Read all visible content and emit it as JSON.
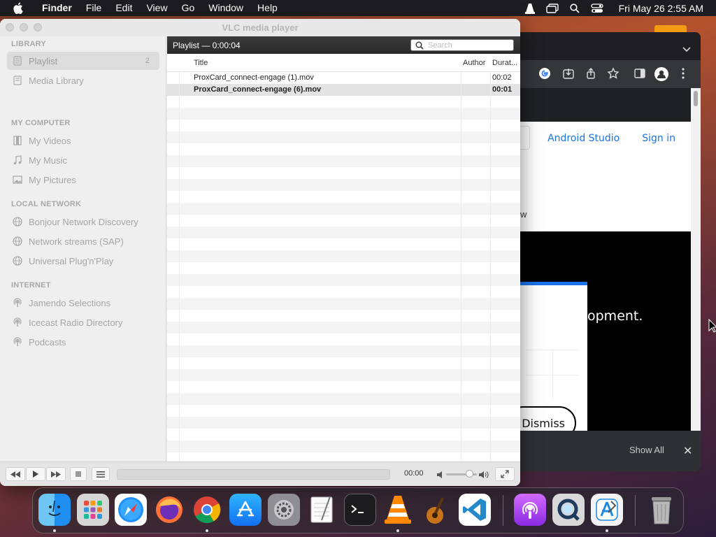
{
  "menubar": {
    "app_name": "Finder",
    "menus": [
      "File",
      "Edit",
      "View",
      "Go",
      "Window",
      "Help"
    ],
    "clock": "Fri May 26  2:55 AM"
  },
  "browser": {
    "header_links": [
      "Android Studio",
      "Sign in"
    ],
    "partial_text": "w",
    "hero_text": "opment.",
    "dismiss_label": "Dismiss",
    "download_bar": {
      "show_all": "Show All",
      "close": "✕"
    }
  },
  "vlc": {
    "title": "VLC media player",
    "sidebar": {
      "sections": [
        {
          "label": "LIBRARY",
          "items": [
            {
              "label": "Playlist",
              "count": "2",
              "icon": "playlist-icon",
              "selected": true
            },
            {
              "label": "Media Library",
              "icon": "media-library-icon"
            }
          ]
        },
        {
          "label": "MY COMPUTER",
          "items": [
            {
              "label": "My Videos",
              "icon": "film-icon"
            },
            {
              "label": "My Music",
              "icon": "music-note-icon"
            },
            {
              "label": "My Pictures",
              "icon": "picture-icon"
            }
          ]
        },
        {
          "label": "LOCAL NETWORK",
          "items": [
            {
              "label": "Bonjour Network Discovery",
              "icon": "network-globe-icon"
            },
            {
              "label": "Network streams (SAP)",
              "icon": "network-globe-icon"
            },
            {
              "label": "Universal Plug'n'Play",
              "icon": "network-globe-icon"
            }
          ]
        },
        {
          "label": "INTERNET",
          "items": [
            {
              "label": "Jamendo Selections",
              "icon": "podcast-icon"
            },
            {
              "label": "Icecast Radio Directory",
              "icon": "podcast-icon"
            },
            {
              "label": "Podcasts",
              "icon": "podcast-icon"
            }
          ]
        }
      ]
    },
    "playlist": {
      "header": "Playlist — 0:00:04",
      "search_placeholder": "Search",
      "columns": {
        "title": "Title",
        "author": "Author",
        "duration": "Durat..."
      },
      "rows": [
        {
          "title": "ProxCard_connect-engage (1).mov",
          "author": "",
          "duration": "00:02",
          "playing": false
        },
        {
          "title": "ProxCard_connect-engage (6).mov",
          "author": "",
          "duration": "00:01",
          "playing": true
        }
      ]
    },
    "controls": {
      "time": "00:00",
      "volume_level": 0.75
    }
  },
  "dock": {
    "apps": [
      "Finder",
      "Launchpad",
      "Safari",
      "Firefox",
      "Google Chrome",
      "App Store",
      "System Preferences",
      "TextEdit",
      "Terminal",
      "VLC",
      "GarageBand",
      "Visual Studio Code",
      "Podcasts",
      "QuickTime Player",
      "Xcode",
      "Trash"
    ]
  }
}
